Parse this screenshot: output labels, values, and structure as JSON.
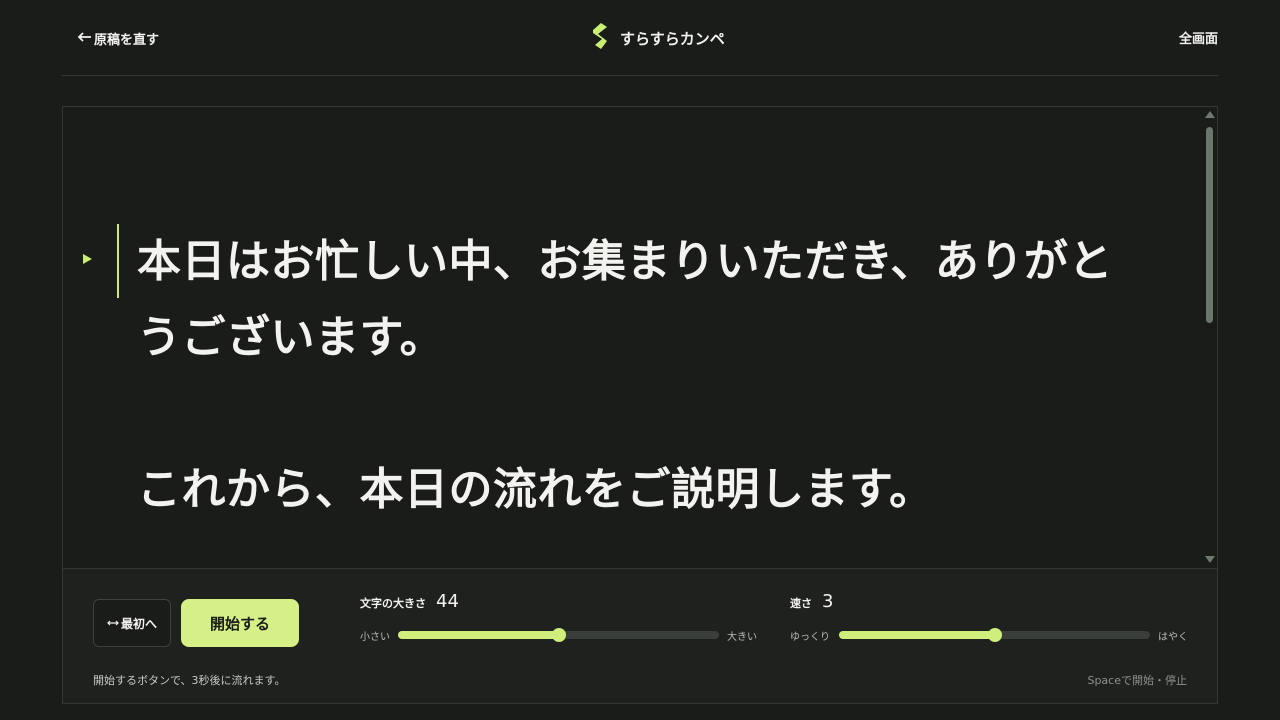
{
  "header": {
    "back_label": "原稿を直す",
    "brand_name": "すらすらカンペ",
    "fullscreen_label": "全画面"
  },
  "script": {
    "paragraphs": [
      "本日はお忙しい中、お集まりいただき、ありがとうございます。",
      "これから、本日の流れをご説明します。"
    ]
  },
  "controls": {
    "restart_label": "最初へ",
    "start_label": "開始する",
    "font_size": {
      "label": "文字の大きさ",
      "value": "44",
      "min_label": "小さい",
      "max_label": "大きい",
      "level": 0.5
    },
    "speed": {
      "label": "速さ",
      "value": "3",
      "min_label": "ゆっくり",
      "max_label": "はやく",
      "level": 0.5
    },
    "hint_left": "開始するボタンで、3秒後に流れます。",
    "hint_right": "Spaceで開始・停止"
  },
  "colors": {
    "background": "#1a1c1a",
    "accent": "#cfee7c",
    "text": "#f2f2ee"
  },
  "icons": {
    "back": "arrow-left-icon",
    "brand": "logo-s-icon",
    "restart": "reset-arrows-icon",
    "current_line": "play-marker-icon"
  }
}
